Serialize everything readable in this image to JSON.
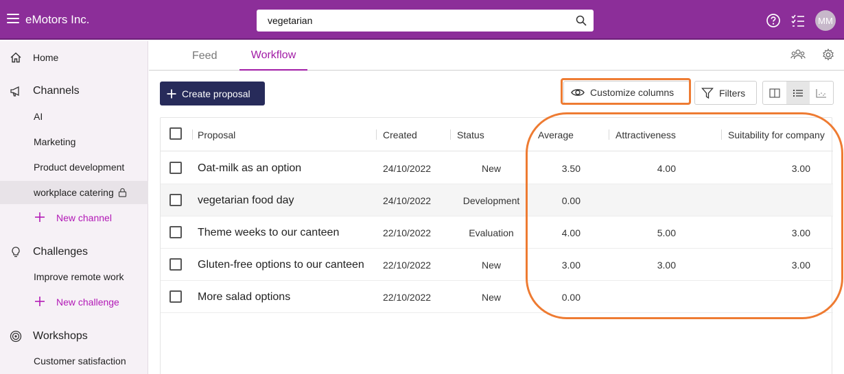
{
  "app": {
    "brand": "eMotors Inc."
  },
  "search": {
    "value": "vegetarian",
    "placeholder": ""
  },
  "user": {
    "initials": "MM"
  },
  "sidebar": {
    "home": "Home",
    "channels": {
      "label": "Channels",
      "items": [
        "AI",
        "Marketing",
        "Product development",
        "workplace catering"
      ],
      "new_label": "New channel",
      "active_item": "workplace catering"
    },
    "challenges": {
      "label": "Challenges",
      "items": [
        "Improve remote work"
      ],
      "new_label": "New challenge"
    },
    "workshops": {
      "label": "Workshops",
      "items": [
        "Customer satisfaction"
      ]
    }
  },
  "tabs": {
    "feed": "Feed",
    "workflow": "Workflow",
    "active": "Workflow"
  },
  "toolbar": {
    "create_label": "Create proposal",
    "customize_label": "Customize columns",
    "filters_label": "Filters"
  },
  "table": {
    "columns": [
      "Proposal",
      "Created",
      "Status",
      "Average",
      "Attractiveness",
      "Suitability for company"
    ],
    "rows": [
      {
        "proposal": "Oat-milk as an option",
        "created": "24/10/2022",
        "status": "New",
        "average": "3.50",
        "attractiveness": "4.00",
        "suitability": "3.00"
      },
      {
        "proposal": "vegetarian food day",
        "created": "24/10/2022",
        "status": "Development",
        "average": "0.00",
        "attractiveness": "",
        "suitability": ""
      },
      {
        "proposal": "Theme weeks to our canteen",
        "created": "22/10/2022",
        "status": "Evaluation",
        "average": "4.00",
        "attractiveness": "5.00",
        "suitability": "3.00"
      },
      {
        "proposal": "Gluten-free options to our canteen",
        "created": "22/10/2022",
        "status": "New",
        "average": "3.00",
        "attractiveness": "3.00",
        "suitability": "3.00"
      },
      {
        "proposal": "More salad options",
        "created": "22/10/2022",
        "status": "New",
        "average": "0.00",
        "attractiveness": "",
        "suitability": ""
      }
    ]
  },
  "colors": {
    "brand": "#8c2e99",
    "accent": "#a11ba6",
    "primary_button": "#272b5a",
    "highlight": "#ee7b32"
  },
  "icons": [
    "menu-icon",
    "search-icon",
    "help-icon",
    "tasks-icon",
    "home-icon",
    "megaphone-icon",
    "lock-icon",
    "plus-icon",
    "lightbulb-icon",
    "target-icon",
    "people-icon",
    "gear-icon",
    "eye-icon",
    "filter-icon",
    "split-view-icon",
    "list-view-icon",
    "chart-view-icon"
  ]
}
